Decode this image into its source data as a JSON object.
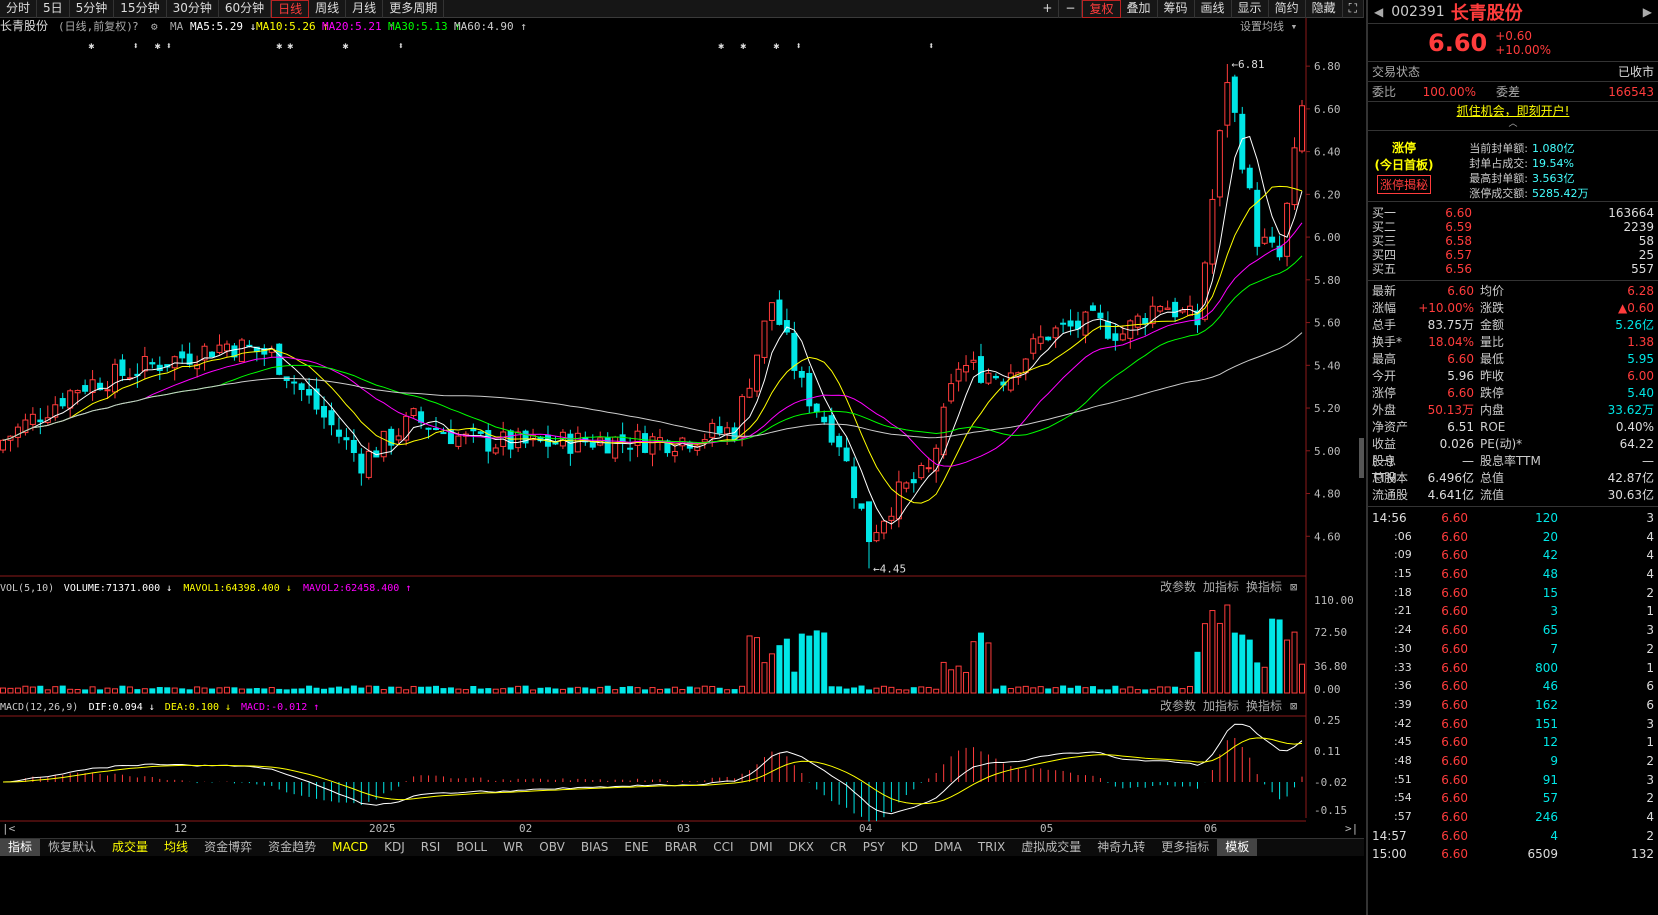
{
  "toolbar": {
    "left": [
      "分时",
      "5日",
      "5分钟",
      "15分钟",
      "30分钟",
      "60分钟",
      "日线",
      "周线",
      "月线",
      "更多周期"
    ],
    "active": "日线",
    "right": [
      "+",
      "−",
      "复权",
      "叠加",
      "筹码",
      "画线",
      "显示",
      "简约",
      "隐藏"
    ]
  },
  "chart": {
    "title": "长青股份",
    "title_note": "(日线,前复权)",
    "ma_legend": [
      {
        "t": "MA5:5.29",
        "c": "#ffffff",
        "a": "↓"
      },
      {
        "t": "MA10:5.26",
        "c": "#ffff00",
        "a": "↑"
      },
      {
        "t": "MA20:5.21",
        "c": "#ff00ff",
        "a": "↑"
      },
      {
        "t": "MA30:5.13",
        "c": "#00ff00",
        "a": "↑"
      },
      {
        "t": "MA60:4.90",
        "c": "#cccccc",
        "a": "↑"
      }
    ],
    "ma_label": "MA",
    "setting": "设置均线",
    "y_ticks": [
      "6.80",
      "6.60",
      "6.40",
      "6.20",
      "6.00",
      "5.80",
      "5.60",
      "5.40",
      "5.20",
      "5.00",
      "4.80",
      "4.60"
    ],
    "high_label": "6.81",
    "low_label": "4.45",
    "vol_legend": [
      {
        "t": "VOL(5,10)",
        "c": "#cccccc"
      },
      {
        "t": "VOLUME:71371.000 ↓",
        "c": "#ffffff"
      },
      {
        "t": "MAVOL1:64398.400 ↓",
        "c": "#ffff00"
      },
      {
        "t": "MAVOL2:62458.400 ↑",
        "c": "#ff00ff"
      }
    ],
    "vol_ticks": [
      "110.00",
      "72.50",
      "36.80",
      "0.00"
    ],
    "macd_legend": [
      {
        "t": "MACD(12,26,9)",
        "c": "#cccccc"
      },
      {
        "t": "DIF:0.094 ↓",
        "c": "#ffffff"
      },
      {
        "t": "DEA:0.100 ↓",
        "c": "#ffff00"
      },
      {
        "t": "MACD:-0.012 ↑",
        "c": "#ff00ff"
      }
    ],
    "macd_ticks": [
      "0.25",
      "0.11",
      "-0.02",
      "-0.15"
    ],
    "panel_btns": [
      "改参数",
      "加指标",
      "换指标"
    ],
    "x_labels": [
      "12",
      "2025",
      "02",
      "03",
      "04",
      "05",
      "06"
    ]
  },
  "bottom": [
    "指标",
    "恢复默认",
    "成交量",
    "均线",
    "资金博弈",
    "资金趋势",
    "MACD",
    "KDJ",
    "RSI",
    "BOLL",
    "WR",
    "OBV",
    "BIAS",
    "ENE",
    "BRAR",
    "CCI",
    "DMI",
    "DKX",
    "CR",
    "PSY",
    "KD",
    "DMA",
    "TRIX",
    "虚拟成交量",
    "神奇九转",
    "更多指标",
    "模板"
  ],
  "quote": {
    "code": "002391",
    "name": "长青股份",
    "price": "6.60",
    "change": "+0.60",
    "pct": "+10.00%",
    "status_label": "交易状态",
    "status": "已收市",
    "wb_label": "委比",
    "wb": "100.00%",
    "wc_label": "委差",
    "wc": "166543",
    "ad": "抓住机会，即刻开户!",
    "limit_title": "涨停",
    "limit_sub": "(今日首板)",
    "limit_btn": "涨停揭秘",
    "limit_info": [
      [
        "当前封单额:",
        "1.080亿"
      ],
      [
        "封单占成交:",
        "19.54%"
      ],
      [
        "最高封单额:",
        "3.563亿"
      ],
      [
        "涨停成交额:",
        "5285.42万"
      ]
    ],
    "bids": [
      [
        "买一",
        "6.60",
        "163664"
      ],
      [
        "买二",
        "6.59",
        "2239"
      ],
      [
        "买三",
        "6.58",
        "58"
      ],
      [
        "买四",
        "6.57",
        "25"
      ],
      [
        "买五",
        "6.56",
        "557"
      ]
    ],
    "stats": [
      [
        "最新",
        "6.60",
        "均价",
        "6.28"
      ],
      [
        "涨幅",
        "+10.00%",
        "涨跌",
        "▲0.60"
      ],
      [
        "总手",
        "83.75万",
        "金额",
        "5.26亿"
      ],
      [
        "换手*",
        "18.04%",
        "量比",
        "1.38"
      ],
      [
        "最高",
        "6.60",
        "最低",
        "5.95"
      ],
      [
        "今开",
        "5.96",
        "昨收",
        "6.00"
      ],
      [
        "涨停",
        "6.60",
        "跌停",
        "5.40"
      ],
      [
        "外盘",
        "50.13万",
        "内盘",
        "33.62万"
      ],
      [
        "净资产",
        "6.51",
        "ROE",
        "0.40%"
      ],
      [
        "收益(一)",
        "0.026",
        "PE(动)*",
        "64.22"
      ],
      [
        "股息TTM",
        "—",
        "股息率TTM",
        "—"
      ],
      [
        "总股本",
        "6.496亿",
        "总值",
        "42.87亿"
      ],
      [
        "流通股",
        "4.641亿",
        "流值",
        "30.63亿"
      ]
    ],
    "ticks": [
      [
        "14:56",
        "6.60",
        "120",
        "3"
      ],
      [
        ":06",
        "6.60",
        "20",
        "4"
      ],
      [
        ":09",
        "6.60",
        "42",
        "4"
      ],
      [
        ":15",
        "6.60",
        "48",
        "4"
      ],
      [
        ":18",
        "6.60",
        "15",
        "2"
      ],
      [
        ":21",
        "6.60",
        "3",
        "1"
      ],
      [
        ":24",
        "6.60",
        "65",
        "3"
      ],
      [
        ":30",
        "6.60",
        "7",
        "2"
      ],
      [
        ":33",
        "6.60",
        "800",
        "1"
      ],
      [
        ":36",
        "6.60",
        "46",
        "6"
      ],
      [
        ":39",
        "6.60",
        "162",
        "6"
      ],
      [
        ":42",
        "6.60",
        "151",
        "3"
      ],
      [
        ":45",
        "6.60",
        "12",
        "1"
      ],
      [
        ":48",
        "6.60",
        "9",
        "2"
      ],
      [
        ":51",
        "6.60",
        "91",
        "3"
      ],
      [
        ":54",
        "6.60",
        "57",
        "2"
      ],
      [
        ":57",
        "6.60",
        "246",
        "4"
      ],
      [
        "14:57",
        "6.60",
        "4",
        "2"
      ],
      [
        "15:00",
        "6.60",
        "6509",
        "132"
      ]
    ]
  }
}
